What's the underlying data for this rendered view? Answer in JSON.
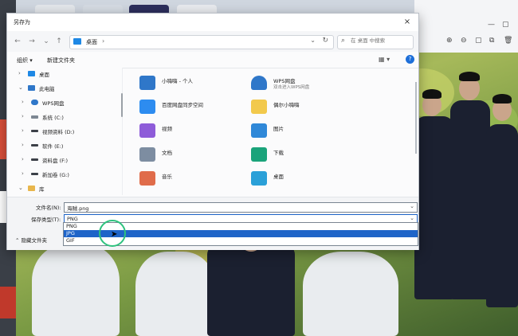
{
  "dialog": {
    "title": "另存为",
    "close": "×",
    "nav": {
      "back": "←",
      "forward": "→",
      "recent": "⌄",
      "up": "↑"
    },
    "address": {
      "location": "桌面",
      "chevron": "›",
      "dropdown": "⌄",
      "refresh": "↻"
    },
    "search": {
      "placeholder": "在 桌面 中搜索"
    },
    "toolbar": {
      "organize": "组织 ▾",
      "new_folder": "新建文件夹",
      "view": "▦ ▾",
      "help": "?"
    },
    "sidebar": [
      {
        "label": "桌面",
        "arrow": "›",
        "icon": "desktop-icon",
        "color": "#1e88e5"
      },
      {
        "label": "此电脑",
        "arrow": "⌄",
        "icon": "pc-icon",
        "color": "#2f77c9"
      },
      {
        "label": "WPS网盘",
        "arrow": "›",
        "icon": "cloud-icon",
        "color": "#2f77c9"
      },
      {
        "label": "系统 (C:)",
        "arrow": "›",
        "icon": "drive-icon",
        "color": "#7d8793"
      },
      {
        "label": "视频资料 (D:)",
        "arrow": "›",
        "icon": "drive-icon",
        "color": "#3c4048"
      },
      {
        "label": "软件 (E:)",
        "arrow": "›",
        "icon": "drive-icon",
        "color": "#3c4048"
      },
      {
        "label": "资料盘 (F:)",
        "arrow": "›",
        "icon": "drive-icon",
        "color": "#3c4048"
      },
      {
        "label": "新加卷 (G:)",
        "arrow": "›",
        "icon": "drive-icon",
        "color": "#3c4048"
      },
      {
        "label": "库",
        "arrow": "⌄",
        "icon": "library-icon",
        "color": "#e8b64c"
      }
    ],
    "files": [
      {
        "name": "小嗨嗨 - 个人",
        "sub": "",
        "icon": "cloud-folder-icon",
        "color": "#2f77c9"
      },
      {
        "name": "WPS网盘",
        "sub": "双击进入WPS网盘",
        "icon": "wps-cloud-icon",
        "color": "#2f77c9"
      },
      {
        "name": "百度网盘同步空间",
        "sub": "",
        "icon": "baidu-sync-icon",
        "color": "#2d8cf0"
      },
      {
        "name": "偶尔小嗨嗨",
        "sub": "",
        "icon": "folder-icon",
        "color": "#f2c94c"
      },
      {
        "name": "视频",
        "sub": "",
        "icon": "video-icon",
        "color": "#8e5cd9"
      },
      {
        "name": "图片",
        "sub": "",
        "icon": "pictures-icon",
        "color": "#2f88d8"
      },
      {
        "name": "文档",
        "sub": "",
        "icon": "documents-icon",
        "color": "#7d8da1"
      },
      {
        "name": "下载",
        "sub": "",
        "icon": "downloads-icon",
        "color": "#1aa37a"
      },
      {
        "name": "音乐",
        "sub": "",
        "icon": "music-icon",
        "color": "#e06c4a"
      },
      {
        "name": "桌面",
        "sub": "",
        "icon": "desktop-folder-icon",
        "color": "#2aa0d8"
      }
    ],
    "filename_label": "文件名(N):",
    "filename_value": "海贼.png",
    "filetype_label": "保存类型(T):",
    "filetype_value": "PNG",
    "filetype_options": [
      "PNG",
      "JPG",
      "GIF"
    ],
    "filetype_selected_index": 1,
    "hide_folders": "⌃ 隐藏文件夹"
  },
  "viewer": {
    "icons": [
      "⊕",
      "⊖",
      "▢",
      "⧉",
      "🗑",
      "⋯"
    ],
    "window_controls": [
      "—",
      "▢"
    ]
  }
}
